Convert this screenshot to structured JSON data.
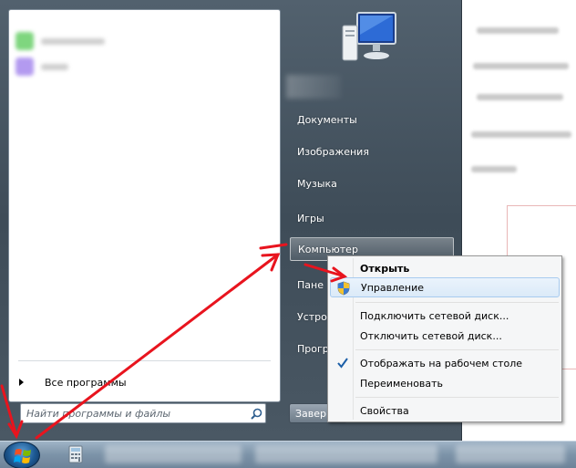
{
  "left_panel": {
    "all_programs": "Все программы",
    "search_placeholder": "Найти программы и файлы"
  },
  "right_panel": {
    "items": [
      "Документы",
      "Изображения",
      "Музыка",
      "Игры",
      "Компьютер",
      "Пане",
      "Устро",
      "Прогр"
    ],
    "shutdown_label": "Завер"
  },
  "context_menu": {
    "items": [
      {
        "label": "Открыть",
        "bold": true
      },
      {
        "label": "Управление",
        "icon": "shield-icon",
        "hovered": true
      },
      {
        "label": "Подключить сетевой диск..."
      },
      {
        "label": "Отключить сетевой диск..."
      },
      {
        "label": "Отображать на рабочем столе",
        "checked": true
      },
      {
        "label": "Переименовать"
      },
      {
        "label": "Свойства"
      }
    ]
  },
  "annotation": {
    "arrow_color": "#e8141e"
  },
  "colors": {
    "start_menu_bg": "#4a5864",
    "context_hover": "#dbeaf8",
    "taskbar": "#7c93a8"
  }
}
